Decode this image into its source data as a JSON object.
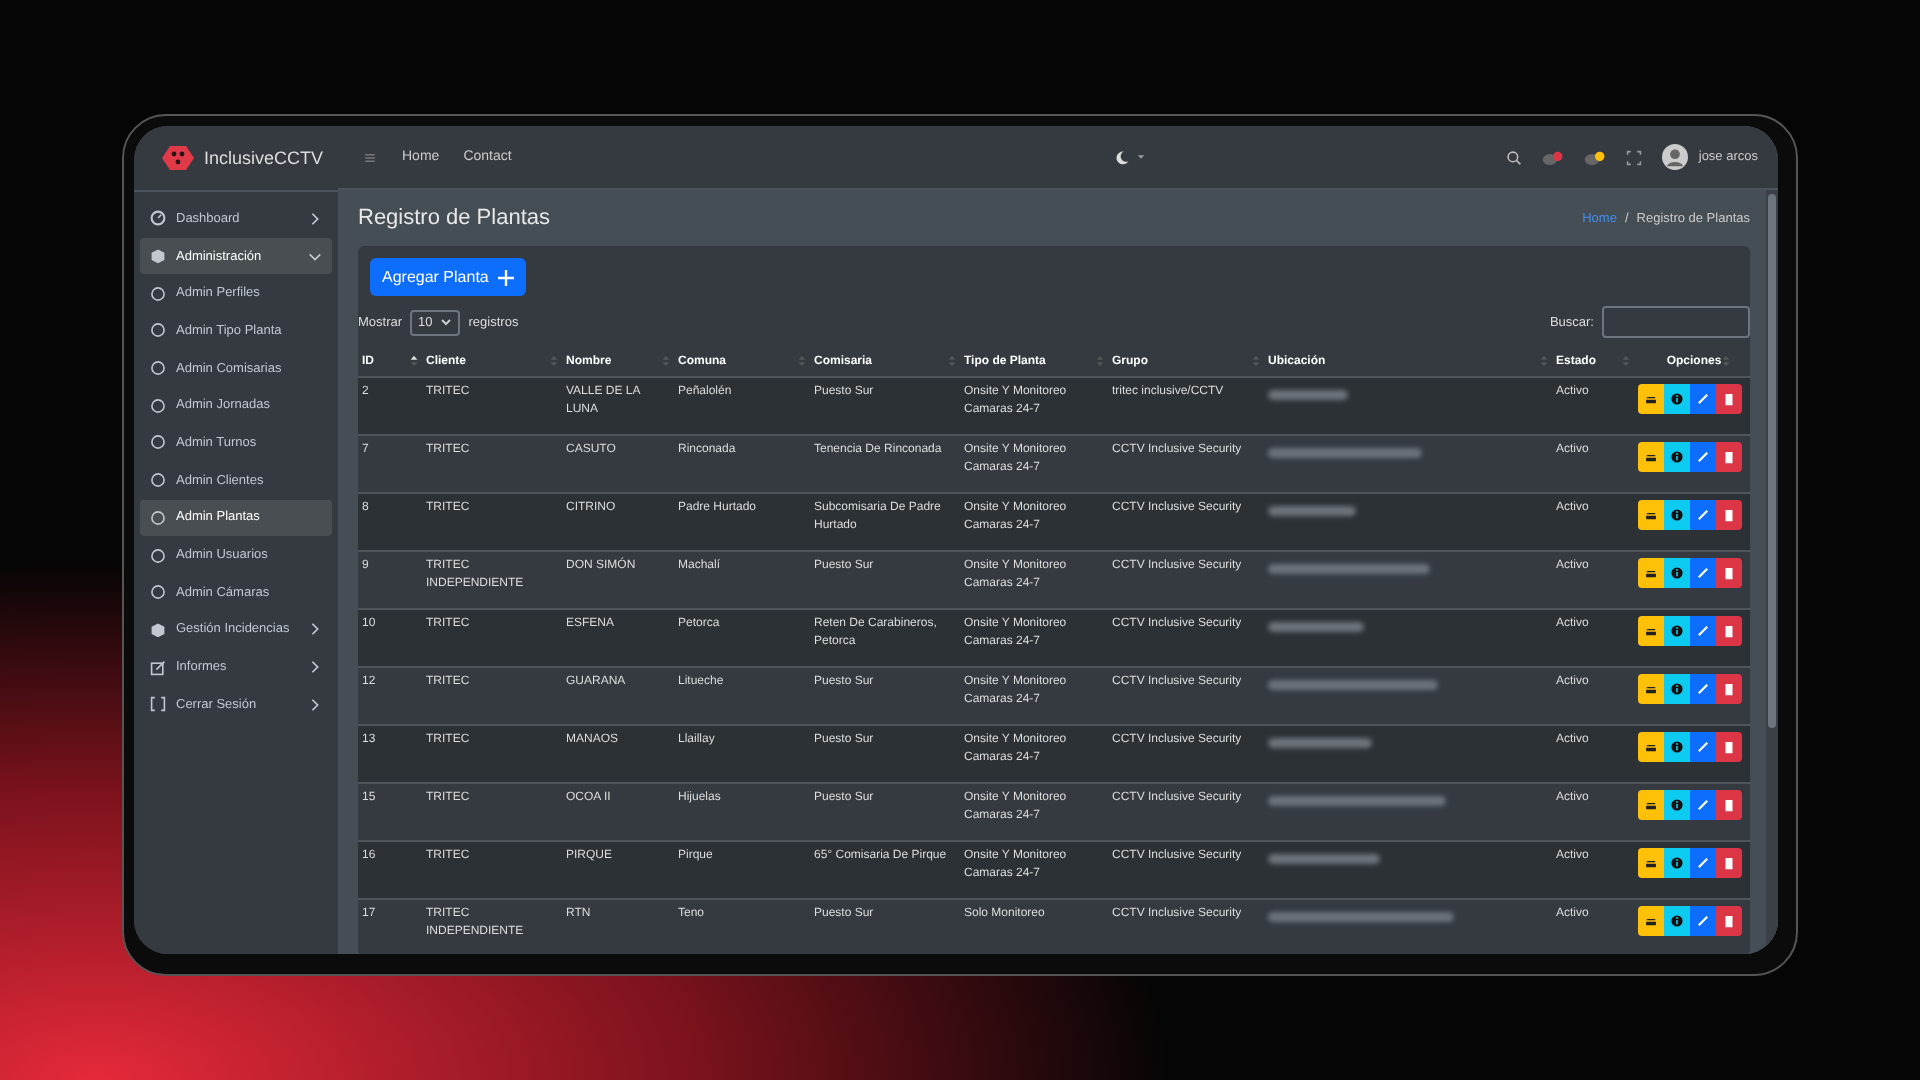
{
  "brand": {
    "name": "InclusiveCCTV"
  },
  "topbar": {
    "links": [
      "Home",
      "Contact"
    ],
    "user": "jose arcos"
  },
  "sidebar": {
    "items": [
      {
        "label": "Dashboard",
        "selected": false,
        "expanded": false
      },
      {
        "label": "Administración",
        "selected": true,
        "expanded": true,
        "children": [
          {
            "label": "Admin Perfiles",
            "selected": false
          },
          {
            "label": "Admin Tipo Planta",
            "selected": false
          },
          {
            "label": "Admin Comisarias",
            "selected": false
          },
          {
            "label": "Admin Jornadas",
            "selected": false
          },
          {
            "label": "Admin Turnos",
            "selected": false
          },
          {
            "label": "Admin Clientes",
            "selected": false
          },
          {
            "label": "Admin Plantas",
            "selected": true
          },
          {
            "label": "Admin Usuarios",
            "selected": false
          },
          {
            "label": "Admin Cámaras",
            "selected": false
          }
        ]
      },
      {
        "label": "Gestión Incidencias",
        "selected": false,
        "expanded": false
      },
      {
        "label": "Informes",
        "selected": false,
        "expanded": false
      },
      {
        "label": "Cerrar Sesión",
        "selected": false,
        "expanded": false
      }
    ]
  },
  "page": {
    "title": "Registro de Plantas",
    "breadcrumb": [
      "Home",
      "Registro de Plantas"
    ],
    "breadcrumb_separator": "/"
  },
  "table_controls": {
    "add_button": "Agregar Planta",
    "show_label": "Mostrar",
    "page_size": "10",
    "records_label": "registros",
    "search_label": "Buscar:"
  },
  "table": {
    "columns": [
      {
        "label": "ID",
        "sorted": true
      },
      {
        "label": "Cliente",
        "sorted": false
      },
      {
        "label": "Nombre",
        "sorted": false
      },
      {
        "label": "Comuna",
        "sorted": false
      },
      {
        "label": "Comisaria",
        "sorted": false
      },
      {
        "label": "Tipo de Planta",
        "sorted": false
      },
      {
        "label": "Grupo",
        "sorted": false
      },
      {
        "label": "Ubicación",
        "sorted": false
      },
      {
        "label": "Estado",
        "sorted": false
      },
      {
        "label": "Opciones",
        "sorted": false
      }
    ],
    "rows": [
      {
        "id": "2",
        "cliente": "TRITEC",
        "nombre": "VALLE DE LA LUNA",
        "comuna": "Peñalolén",
        "comisaria": "Puesto Sur",
        "tipo": "Onsite Y Monitoreo Camaras 24-7",
        "grupo": "tritec inclusive/CCTV",
        "estado": "Activo"
      },
      {
        "id": "7",
        "cliente": "TRITEC",
        "nombre": "CASUTO",
        "comuna": "Rinconada",
        "comisaria": "Tenencia De Rinconada",
        "tipo": "Onsite Y Monitoreo Camaras 24-7",
        "grupo": "CCTV Inclusive Security",
        "estado": "Activo"
      },
      {
        "id": "8",
        "cliente": "TRITEC",
        "nombre": "CITRINO",
        "comuna": "Padre Hurtado",
        "comisaria": "Subcomisaria De Padre Hurtado",
        "tipo": "Onsite Y Monitoreo Camaras 24-7",
        "grupo": "CCTV Inclusive Security",
        "estado": "Activo"
      },
      {
        "id": "9",
        "cliente": "TRITEC INDEPENDIENTE",
        "nombre": "DON SIMÓN",
        "comuna": "Machalí",
        "comisaria": "Puesto Sur",
        "tipo": "Onsite Y Monitoreo Camaras 24-7",
        "grupo": "CCTV Inclusive Security",
        "estado": "Activo"
      },
      {
        "id": "10",
        "cliente": "TRITEC",
        "nombre": "ESFENA",
        "comuna": "Petorca",
        "comisaria": "Reten De Carabineros, Petorca",
        "tipo": "Onsite Y Monitoreo Camaras 24-7",
        "grupo": "CCTV Inclusive Security",
        "estado": "Activo"
      },
      {
        "id": "12",
        "cliente": "TRITEC",
        "nombre": "GUARANA",
        "comuna": "Litueche",
        "comisaria": "Puesto Sur",
        "tipo": "Onsite Y Monitoreo Camaras 24-7",
        "grupo": "CCTV Inclusive Security",
        "estado": "Activo"
      },
      {
        "id": "13",
        "cliente": "TRITEC",
        "nombre": "MANAOS",
        "comuna": "Llaillay",
        "comisaria": "Puesto Sur",
        "tipo": "Onsite Y Monitoreo Camaras 24-7",
        "grupo": "CCTV Inclusive Security",
        "estado": "Activo"
      },
      {
        "id": "15",
        "cliente": "TRITEC",
        "nombre": "OCOA II",
        "comuna": "Hijuelas",
        "comisaria": "Puesto Sur",
        "tipo": "Onsite Y Monitoreo Camaras 24-7",
        "grupo": "CCTV Inclusive Security",
        "estado": "Activo"
      },
      {
        "id": "16",
        "cliente": "TRITEC",
        "nombre": "PIRQUE",
        "comuna": "Pirque",
        "comisaria": "65° Comisaria De Pirque",
        "tipo": "Onsite Y Monitoreo Camaras 24-7",
        "grupo": "CCTV Inclusive Security",
        "estado": "Activo"
      },
      {
        "id": "17",
        "cliente": "TRITEC INDEPENDIENTE",
        "nombre": "RTN",
        "comuna": "Teno",
        "comisaria": "Puesto Sur",
        "tipo": "Solo Monitoreo",
        "grupo": "CCTV Inclusive Security",
        "estado": "Activo"
      }
    ]
  }
}
